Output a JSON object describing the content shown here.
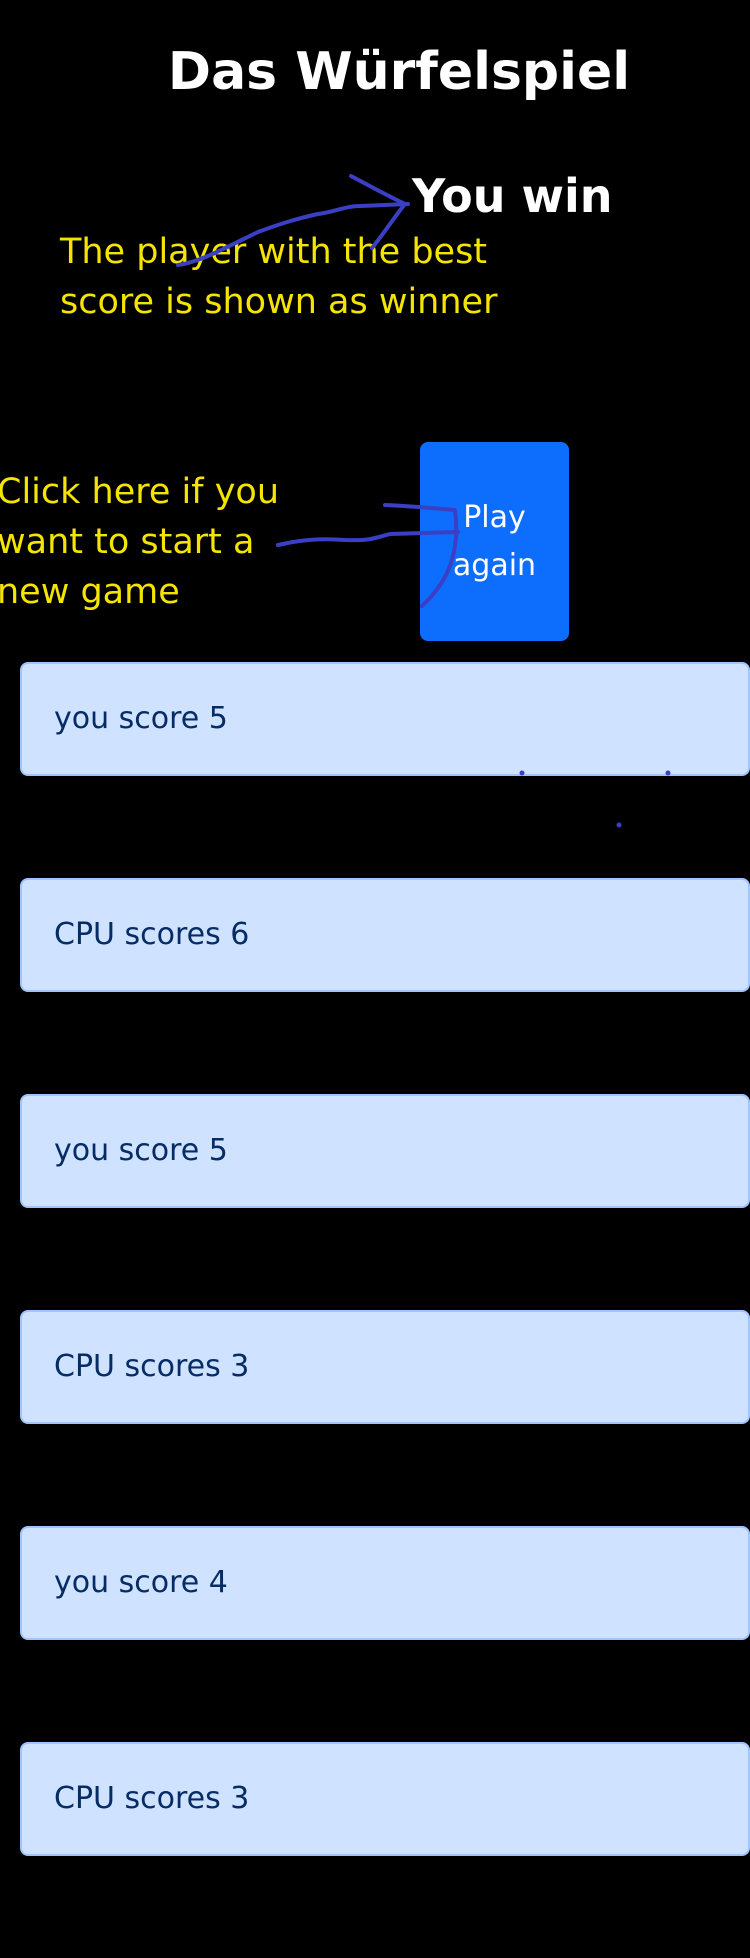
{
  "header": {
    "title": "Das Würfelspiel"
  },
  "result": {
    "text": "You win"
  },
  "annotations": {
    "winner_note": "The player with the best score is shown as winner",
    "new_game_note": "Click here if you want to start a new game"
  },
  "actions": {
    "play_again_label": "Play again"
  },
  "scores": [
    {
      "text": "you score 5"
    },
    {
      "text": "CPU scores 6"
    },
    {
      "text": "you score 5"
    },
    {
      "text": "CPU scores 3"
    },
    {
      "text": "you score 4"
    },
    {
      "text": "CPU scores 3"
    }
  ],
  "colors": {
    "background": "#000000",
    "title": "#ffffff",
    "note_text": "#f5e400",
    "button": "#0d6efd",
    "score_item_bg": "#cfe2ff",
    "score_item_border": "#9ec5fe",
    "score_item_text": "#052c65",
    "pen_stroke": "#3a3fc4"
  }
}
